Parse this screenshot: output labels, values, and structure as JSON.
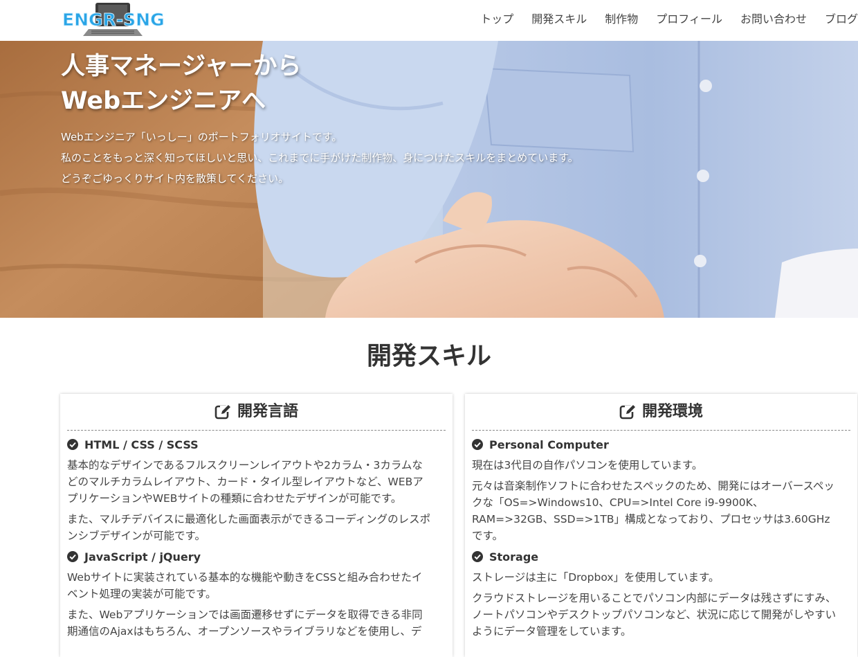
{
  "header": {
    "logo_text": "ENGR-SNG",
    "nav": [
      "トップ",
      "開発スキル",
      "制作物",
      "プロフィール",
      "お問い合わせ",
      "ブログ"
    ]
  },
  "hero": {
    "title_lines": [
      "人事マネージャーから",
      "Webエンジニアへ"
    ],
    "text_lines": [
      "Webエンジニア「いっしー」のポートフォリオサイトです。",
      "私のことをもっと深く知ってほしいと思い、これまでに手がけた制作物、身につけたスキルをまとめています。",
      "どうぞごゆっくりサイト内を散策してください。"
    ]
  },
  "skills": {
    "title": "開発スキル",
    "cards": [
      {
        "title": "開発言語",
        "icon": "edit-icon",
        "items": [
          {
            "title": "HTML / CSS / SCSS",
            "paragraphs": [
              [
                "基本的なデザインであるフルスクリーンレイアウトや2カラム・3カラムな",
                "どのマルチカラムレイアウト、カード・タイル型レイアウトなど、WEBア",
                "プリケーションやWEBサイトの種類に合わせたデザインが可能です。"
              ],
              [
                "また、マルチデバイスに最適化した画面表示ができるコーディングのレスポ",
                "ンシブデザインが可能です。"
              ]
            ]
          },
          {
            "title": "JavaScript / jQuery",
            "paragraphs": [
              [
                "Webサイトに実装されている基本的な機能や動きをCSSと組み合わせたイ",
                "ベント処理の実装が可能です。"
              ],
              [
                "また、Webアプリケーションでは画面遷移せずにデータを取得できる非同",
                "期通信のAjaxはもちろん、オープンソースやライブラリなどを使用し、デ"
              ]
            ]
          }
        ]
      },
      {
        "title": "開発環境",
        "icon": "edit-icon",
        "items": [
          {
            "title": "Personal Computer",
            "paragraphs": [
              [
                "現在は3代目の自作パソコンを使用しています。"
              ],
              [
                "元々は音楽制作ソフトに合わせたスペックのため、開発にはオーバースペッ",
                "クな「OS=>Windows10、CPU=>Intel Core i9-9900K、",
                "RAM=>32GB、SSD=>1TB」構成となっており、プロセッサは3.60GHz",
                "です。"
              ]
            ]
          },
          {
            "title": "Storage",
            "paragraphs": [
              [
                "ストレージは主に「Dropbox」を使用しています。"
              ],
              [
                "クラウドストレージを用いることでパソコン内部にデータは残さずにすみ、",
                "ノートパソコンやデスクトップパソコンなど、状況に応じて開発がしやすい",
                "ようにデータ管理をしています。"
              ]
            ]
          }
        ]
      }
    ]
  },
  "colors": {
    "text": "#333333",
    "logo_blue": "#2aa5e6",
    "white": "#ffffff"
  }
}
